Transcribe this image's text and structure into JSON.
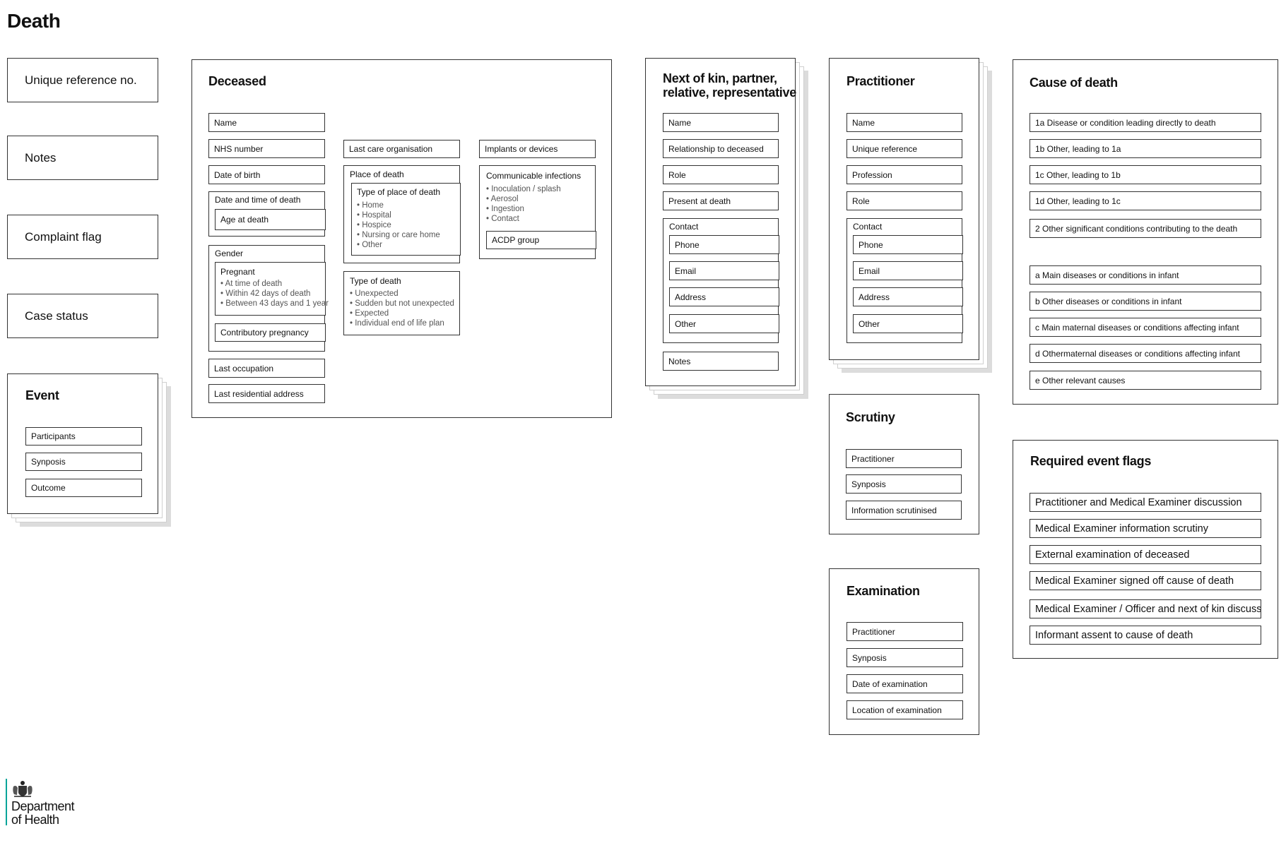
{
  "page": {
    "title": "Death"
  },
  "left_fields": [
    "Unique reference no.",
    "Notes",
    "Complaint flag",
    "Case status"
  ],
  "event": {
    "title": "Event",
    "fields": [
      "Participants",
      "Synposis",
      "Outcome"
    ]
  },
  "deceased": {
    "title": "Deceased",
    "name": "Name",
    "nhs_number": "NHS number",
    "date_of_birth": "Date of birth",
    "date_time_of_death": "Date and time of death",
    "age_at_death": "Age at death",
    "gender": "Gender",
    "pregnant": {
      "label": "Pregnant",
      "options": [
        "At time of death",
        "Within 42 days of death",
        "Between 43 days and 1 year"
      ]
    },
    "contributory_pregnancy": "Contributory pregnancy",
    "last_occupation": "Last occupation",
    "last_residential_address": "Last residential address",
    "last_care_organisation": "Last care organisation",
    "place_of_death": {
      "label": "Place of death",
      "type_label": "Type of place of death",
      "options": [
        "Home",
        "Hospital",
        "Hospice",
        "Nursing or care home",
        "Other"
      ]
    },
    "type_of_death": {
      "label": "Type of death",
      "options": [
        "Unexpected",
        "Sudden but not unexpected",
        "Expected",
        "Individual end of life plan"
      ]
    },
    "implants_or_devices": "Implants or devices",
    "communicable_infections": {
      "label": "Communicable infections",
      "options": [
        "Inoculation / splash",
        "Aerosol",
        "Ingestion",
        "Contact"
      ]
    },
    "acdp_group": "ACDP group"
  },
  "next_of_kin": {
    "title_line1": "Next of kin, partner,",
    "title_line2": "relative, representative",
    "fields": [
      "Name",
      "Relationship to deceased",
      "Role",
      "Present at death"
    ],
    "contact": {
      "label": "Contact",
      "fields": [
        "Phone",
        "Email",
        "Address",
        "Other"
      ]
    },
    "notes": "Notes"
  },
  "practitioner": {
    "title": "Practitioner",
    "fields": [
      "Name",
      "Unique reference",
      "Profession",
      "Role"
    ],
    "contact": {
      "label": "Contact",
      "fields": [
        "Phone",
        "Email",
        "Address",
        "Other"
      ]
    }
  },
  "scrutiny": {
    "title": "Scrutiny",
    "fields": [
      "Practitioner",
      "Synposis",
      "Information scrutinised"
    ]
  },
  "examination": {
    "title": "Examination",
    "fields": [
      "Practitioner",
      "Synposis",
      "Date of examination",
      "Location of examination"
    ]
  },
  "cause_of_death": {
    "title": "Cause of death",
    "fields": [
      "1a Disease or condition leading directly to death",
      "1b Other, leading to 1a",
      "1c Other, leading to 1b",
      "1d Other, leading to 1c",
      "2 Other significant conditions contributing to the death",
      "a Main diseases or conditions in infant",
      "b Other diseases or conditions in infant",
      "c Main maternal diseases or conditions affecting infant",
      "d Othermaternal diseases or conditions affecting infant",
      "e Other relevant causes"
    ]
  },
  "required_event_flags": {
    "title": "Required event flags",
    "fields": [
      "Practitioner and Medical Examiner discussion",
      "Medical Examiner information scrutiny",
      "External examination of deceased",
      "Medical Examiner signed off cause of death",
      "Medical Examiner / Officer and next of kin discussion",
      "Informant assent to cause of death"
    ]
  },
  "logo": {
    "line1": "Department",
    "line2": "of Health",
    "crest": "royal-coat-of-arms-icon",
    "accent_color": "#00a499"
  }
}
